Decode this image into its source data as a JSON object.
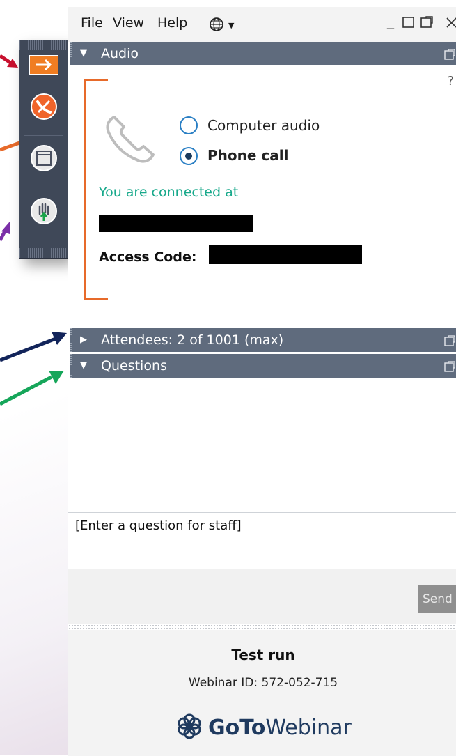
{
  "menubar": {
    "items": [
      "File",
      "View",
      "Help"
    ],
    "language_icon": "globe-icon",
    "window_controls": [
      "minimize-icon",
      "maximize-icon",
      "popout-icon",
      "close-icon"
    ]
  },
  "toolbar": {
    "buttons": [
      {
        "icon": "arrow-right-icon",
        "color": "#f07d22"
      },
      {
        "icon": "mute-phone-icon",
        "color": "#f0642a"
      },
      {
        "icon": "window-icon",
        "color": "#e9e9e9"
      },
      {
        "icon": "raise-hand-icon",
        "color": "#e9e9e9"
      }
    ]
  },
  "audio": {
    "header": "Audio",
    "help": "?",
    "options": [
      {
        "label": "Computer audio",
        "checked": false
      },
      {
        "label": "Phone call",
        "checked": true
      }
    ],
    "connected_text": "You are connected at",
    "access_code_label": "Access Code:"
  },
  "attendees": {
    "header": "Attendees:  2 of 1001 (max)"
  },
  "questions": {
    "header": "Questions",
    "input_placeholder": "[Enter a question for staff]",
    "send_label": "Send"
  },
  "footer": {
    "title": "Test run",
    "webinar_id": "Webinar ID: 572-052-715",
    "brand_bold": "GoTo",
    "brand_regular": "Webinar"
  },
  "colors": {
    "section_header": "#5f6b7d",
    "accent_orange": "#e76a2a",
    "connected_green": "#18a98b",
    "toolbar_bg": "#3f4858"
  }
}
